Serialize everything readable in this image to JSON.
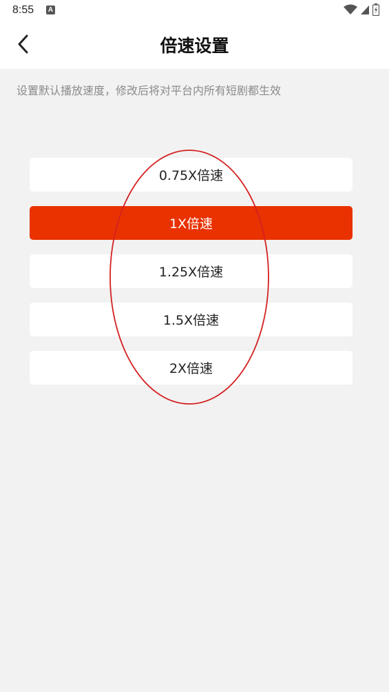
{
  "status_bar": {
    "time": "8:55",
    "notification_icon_letter": "A",
    "icons": [
      "wifi-icon",
      "cellular-signal-icon",
      "battery-charging-icon"
    ]
  },
  "header": {
    "title": "倍速设置",
    "back_icon": "chevron-left-icon"
  },
  "description": "设置默认播放速度，修改后将对平台内所有短剧都生效",
  "speed_options": [
    {
      "label": "0.75X倍速",
      "selected": false
    },
    {
      "label": "1X倍速",
      "selected": true
    },
    {
      "label": "1.25X倍速",
      "selected": false
    },
    {
      "label": "1.5X倍速",
      "selected": false
    },
    {
      "label": "2X倍速",
      "selected": false
    }
  ],
  "colors": {
    "accent": "#e93200",
    "background": "#f2f2f2",
    "annotation": "#d42020"
  }
}
